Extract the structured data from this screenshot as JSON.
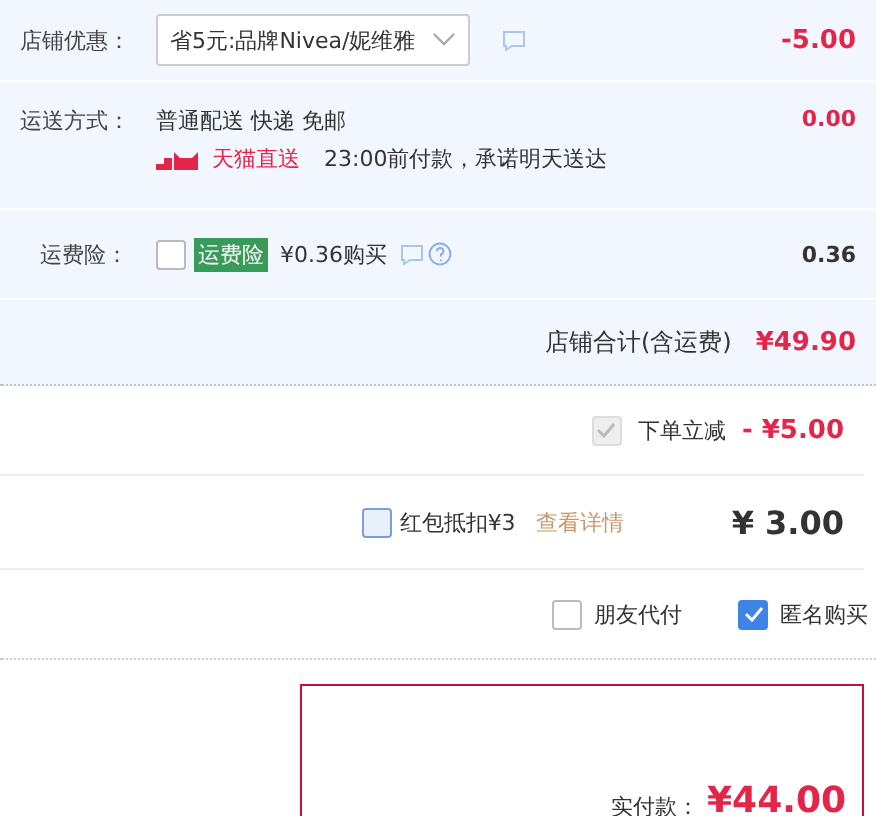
{
  "shop_discount": {
    "label": "店铺优惠：",
    "select_value": "省5元:品牌Nivea/妮维雅",
    "amount": "-5.00"
  },
  "shipping": {
    "label": "运送方式：",
    "method": "普通配送 快递 免邮",
    "badge": "天猫直送",
    "promise": "23:00前付款，承诺明天送达",
    "amount": "0.00"
  },
  "insurance": {
    "label": "运费险：",
    "checked": false,
    "tag": "运费险",
    "price": "¥0.36购买",
    "amount": "0.36"
  },
  "shop_total": {
    "label": "店铺合计(含运费)",
    "amount": "¥49.90"
  },
  "instant_discount": {
    "checked": true,
    "disabled": true,
    "label": "下单立减",
    "amount": "- ¥5.00"
  },
  "red_packet": {
    "checked": false,
    "label": "红包抵扣¥3",
    "link": "查看详情",
    "amount": "¥ 3.00"
  },
  "options": [
    {
      "label": "朋友代付",
      "checked": false
    },
    {
      "label": "匿名购买",
      "checked": true
    }
  ],
  "payment": {
    "label": "实付款：",
    "amount": "¥44.00"
  }
}
